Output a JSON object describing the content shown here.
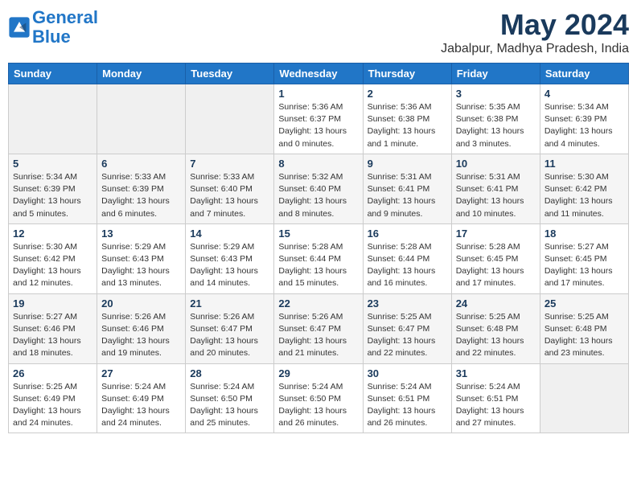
{
  "logo": {
    "line1": "General",
    "line2": "Blue"
  },
  "title": "May 2024",
  "subtitle": "Jabalpur, Madhya Pradesh, India",
  "weekdays": [
    "Sunday",
    "Monday",
    "Tuesday",
    "Wednesday",
    "Thursday",
    "Friday",
    "Saturday"
  ],
  "weeks": [
    [
      {
        "day": "",
        "info": ""
      },
      {
        "day": "",
        "info": ""
      },
      {
        "day": "",
        "info": ""
      },
      {
        "day": "1",
        "info": "Sunrise: 5:36 AM\nSunset: 6:37 PM\nDaylight: 13 hours\nand 0 minutes."
      },
      {
        "day": "2",
        "info": "Sunrise: 5:36 AM\nSunset: 6:38 PM\nDaylight: 13 hours\nand 1 minute."
      },
      {
        "day": "3",
        "info": "Sunrise: 5:35 AM\nSunset: 6:38 PM\nDaylight: 13 hours\nand 3 minutes."
      },
      {
        "day": "4",
        "info": "Sunrise: 5:34 AM\nSunset: 6:39 PM\nDaylight: 13 hours\nand 4 minutes."
      }
    ],
    [
      {
        "day": "5",
        "info": "Sunrise: 5:34 AM\nSunset: 6:39 PM\nDaylight: 13 hours\nand 5 minutes."
      },
      {
        "day": "6",
        "info": "Sunrise: 5:33 AM\nSunset: 6:39 PM\nDaylight: 13 hours\nand 6 minutes."
      },
      {
        "day": "7",
        "info": "Sunrise: 5:33 AM\nSunset: 6:40 PM\nDaylight: 13 hours\nand 7 minutes."
      },
      {
        "day": "8",
        "info": "Sunrise: 5:32 AM\nSunset: 6:40 PM\nDaylight: 13 hours\nand 8 minutes."
      },
      {
        "day": "9",
        "info": "Sunrise: 5:31 AM\nSunset: 6:41 PM\nDaylight: 13 hours\nand 9 minutes."
      },
      {
        "day": "10",
        "info": "Sunrise: 5:31 AM\nSunset: 6:41 PM\nDaylight: 13 hours\nand 10 minutes."
      },
      {
        "day": "11",
        "info": "Sunrise: 5:30 AM\nSunset: 6:42 PM\nDaylight: 13 hours\nand 11 minutes."
      }
    ],
    [
      {
        "day": "12",
        "info": "Sunrise: 5:30 AM\nSunset: 6:42 PM\nDaylight: 13 hours\nand 12 minutes."
      },
      {
        "day": "13",
        "info": "Sunrise: 5:29 AM\nSunset: 6:43 PM\nDaylight: 13 hours\nand 13 minutes."
      },
      {
        "day": "14",
        "info": "Sunrise: 5:29 AM\nSunset: 6:43 PM\nDaylight: 13 hours\nand 14 minutes."
      },
      {
        "day": "15",
        "info": "Sunrise: 5:28 AM\nSunset: 6:44 PM\nDaylight: 13 hours\nand 15 minutes."
      },
      {
        "day": "16",
        "info": "Sunrise: 5:28 AM\nSunset: 6:44 PM\nDaylight: 13 hours\nand 16 minutes."
      },
      {
        "day": "17",
        "info": "Sunrise: 5:28 AM\nSunset: 6:45 PM\nDaylight: 13 hours\nand 17 minutes."
      },
      {
        "day": "18",
        "info": "Sunrise: 5:27 AM\nSunset: 6:45 PM\nDaylight: 13 hours\nand 17 minutes."
      }
    ],
    [
      {
        "day": "19",
        "info": "Sunrise: 5:27 AM\nSunset: 6:46 PM\nDaylight: 13 hours\nand 18 minutes."
      },
      {
        "day": "20",
        "info": "Sunrise: 5:26 AM\nSunset: 6:46 PM\nDaylight: 13 hours\nand 19 minutes."
      },
      {
        "day": "21",
        "info": "Sunrise: 5:26 AM\nSunset: 6:47 PM\nDaylight: 13 hours\nand 20 minutes."
      },
      {
        "day": "22",
        "info": "Sunrise: 5:26 AM\nSunset: 6:47 PM\nDaylight: 13 hours\nand 21 minutes."
      },
      {
        "day": "23",
        "info": "Sunrise: 5:25 AM\nSunset: 6:47 PM\nDaylight: 13 hours\nand 22 minutes."
      },
      {
        "day": "24",
        "info": "Sunrise: 5:25 AM\nSunset: 6:48 PM\nDaylight: 13 hours\nand 22 minutes."
      },
      {
        "day": "25",
        "info": "Sunrise: 5:25 AM\nSunset: 6:48 PM\nDaylight: 13 hours\nand 23 minutes."
      }
    ],
    [
      {
        "day": "26",
        "info": "Sunrise: 5:25 AM\nSunset: 6:49 PM\nDaylight: 13 hours\nand 24 minutes."
      },
      {
        "day": "27",
        "info": "Sunrise: 5:24 AM\nSunset: 6:49 PM\nDaylight: 13 hours\nand 24 minutes."
      },
      {
        "day": "28",
        "info": "Sunrise: 5:24 AM\nSunset: 6:50 PM\nDaylight: 13 hours\nand 25 minutes."
      },
      {
        "day": "29",
        "info": "Sunrise: 5:24 AM\nSunset: 6:50 PM\nDaylight: 13 hours\nand 26 minutes."
      },
      {
        "day": "30",
        "info": "Sunrise: 5:24 AM\nSunset: 6:51 PM\nDaylight: 13 hours\nand 26 minutes."
      },
      {
        "day": "31",
        "info": "Sunrise: 5:24 AM\nSunset: 6:51 PM\nDaylight: 13 hours\nand 27 minutes."
      },
      {
        "day": "",
        "info": ""
      }
    ]
  ]
}
